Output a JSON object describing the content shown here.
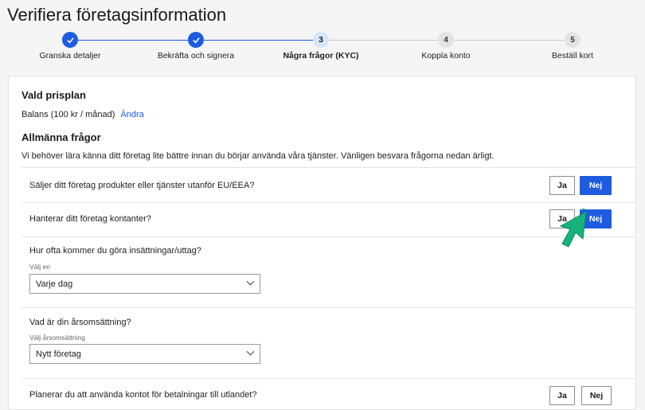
{
  "page": {
    "title": "Verifiera företagsinformation"
  },
  "stepper": {
    "steps": [
      {
        "label": "Granska detaljer",
        "number": "1",
        "status": "done"
      },
      {
        "label": "Bekräfta och signera",
        "number": "2",
        "status": "done"
      },
      {
        "label": "Några frågor (KYC)",
        "number": "3",
        "status": "current"
      },
      {
        "label": "Koppla konto",
        "number": "4",
        "status": "todo"
      },
      {
        "label": "Beställ kort",
        "number": "5",
        "status": "todo"
      }
    ]
  },
  "plan": {
    "heading": "Vald prisplan",
    "value": "Balans (100 kr / månad)",
    "change_link": "Ändra"
  },
  "general": {
    "heading": "Allmänna frågor",
    "intro": "Vi behöver lära känna ditt företag lite bättre innan du börjar använda våra tjänster. Vänligen besvara frågorna nedan ärligt."
  },
  "questions": {
    "q1": {
      "label": "Säljer ditt företag produkter eller tjänster utanför EU/EEA?",
      "yes": "Ja",
      "no": "Nej",
      "selected": "Nej"
    },
    "q2": {
      "label": "Hanterar ditt företag kontanter?",
      "yes": "Ja",
      "no": "Nej",
      "selected": "Nej"
    },
    "q3": {
      "label": "Hur ofta kommer du göra insättningar/uttag?",
      "select_label": "Välj en",
      "value": "Varje dag"
    },
    "q4": {
      "label": "Vad är din årsomsättning?",
      "select_label": "Välj årsomsättning",
      "value": "Nytt företag"
    },
    "q5": {
      "label": "Planerar du att använda kontot för betalningar till utlandet?",
      "yes": "Ja",
      "no": "Nej"
    }
  },
  "colors": {
    "accent": "#1d5ce0",
    "cursor": "#17b27a"
  },
  "icons": {
    "check": "check-icon",
    "chevron": "chevron-down-icon",
    "cursor": "pointer-cursor-icon"
  }
}
